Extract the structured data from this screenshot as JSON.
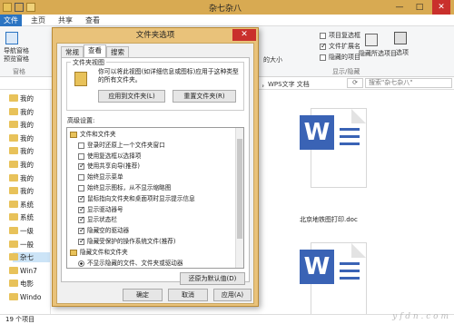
{
  "window": {
    "title": "杂七杂八",
    "minimize": "—",
    "maximize": "□",
    "close": "✕"
  },
  "ribbon_tabs": {
    "file": "文件",
    "home": "主页",
    "share": "共享",
    "view": "查看"
  },
  "ribbon": {
    "nav_pane": "导航窗格",
    "preview_pane": "预览窗格",
    "pane_group": "窗格",
    "item_checkboxes": "项目复选框",
    "file_extensions": "文件扩展名",
    "hidden_items": "隐藏的项目",
    "hide_selected_items": "隐藏所选项目",
    "options": "选项",
    "show_hide_group": "显示/隐藏",
    "size_fragment": "的大小",
    "extensions_checked": true
  },
  "address_bar": {
    "search_placeholder": "搜索\"杂七杂八\"",
    "wps_fragment": "，WPS文字 文档"
  },
  "nav_items": [
    {
      "label": "我的"
    },
    {
      "label": "我的"
    },
    {
      "label": "我的"
    },
    {
      "label": "我的"
    },
    {
      "label": "我的"
    },
    {
      "label": "我的"
    },
    {
      "label": "我的"
    },
    {
      "label": "我的"
    },
    {
      "label": "系统"
    },
    {
      "label": "系统"
    },
    {
      "label": "一级"
    },
    {
      "label": "一般"
    },
    {
      "label": "杂七"
    },
    {
      "label": "Win7"
    },
    {
      "label": "电影"
    },
    {
      "label": "Windo"
    }
  ],
  "files": [
    {
      "name": "北京地铁图打印.doc"
    },
    {
      "name": ""
    }
  ],
  "status": {
    "item_count": "19 个项目"
  },
  "watermark": "y f d n . c o m",
  "dialog": {
    "title": "文件夹选项",
    "close": "✕",
    "tabs": [
      "常规",
      "查看",
      "搜索"
    ],
    "folder_view_label": "文件夹视图",
    "folder_view_text": "你可以将此视图(如详细信息或图标)应用于这种类型的所有文件夹。",
    "apply_button": "应用到文件夹(L)",
    "reset_button": "重置文件夹(R)",
    "advanced_label": "高级设置:",
    "restore_button": "还原为默认值(D)",
    "ok": "确定",
    "cancel": "取消",
    "apply": "应用(A)",
    "advanced_items": [
      {
        "label": "文件和文件夹",
        "type": "folder",
        "checked": false
      },
      {
        "label": "登录时还原上一个文件夹窗口",
        "type": "check",
        "checked": false
      },
      {
        "label": "使用复选框以选择项",
        "type": "check",
        "checked": false
      },
      {
        "label": "使用共享向导(推荐)",
        "type": "check",
        "checked": true
      },
      {
        "label": "始终显示菜单",
        "type": "check",
        "checked": false
      },
      {
        "label": "始终显示图标，从不显示缩略图",
        "type": "check",
        "checked": false
      },
      {
        "label": "鼠标指向文件夹和桌面项时显示提示信息",
        "type": "check",
        "checked": true
      },
      {
        "label": "显示驱动器号",
        "type": "check",
        "checked": true
      },
      {
        "label": "显示状态栏",
        "type": "check",
        "checked": true
      },
      {
        "label": "隐藏空的驱动器",
        "type": "check",
        "checked": true
      },
      {
        "label": "隐藏受保护的操作系统文件(推荐)",
        "type": "check",
        "checked": true
      },
      {
        "label": "隐藏文件和文件夹",
        "type": "folder",
        "checked": false
      },
      {
        "label": "不显示隐藏的文件、文件夹或驱动器",
        "type": "radio",
        "checked": true
      }
    ]
  }
}
